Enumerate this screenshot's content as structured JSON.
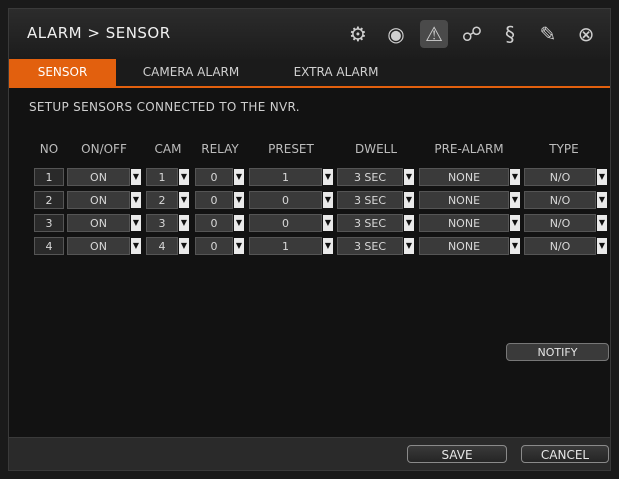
{
  "title": "ALARM > SENSOR",
  "toolbar_icons": [
    "gear-icon",
    "camera-lens-icon",
    "record-device-alert-icon",
    "network-icon",
    "system-icon",
    "pen-icon",
    "close-icon"
  ],
  "tabs": [
    {
      "label": "SENSOR",
      "active": true
    },
    {
      "label": "CAMERA ALARM",
      "active": false
    },
    {
      "label": "EXTRA ALARM",
      "active": false
    }
  ],
  "subtitle": "SETUP SENSORS CONNECTED TO THE NVR.",
  "columns": [
    "NO",
    "ON/OFF",
    "CAM",
    "RELAY",
    "PRESET",
    "DWELL",
    "PRE-ALARM",
    "TYPE"
  ],
  "rows": [
    {
      "no": "1",
      "on_off": "ON",
      "cam": "1",
      "relay": "0",
      "preset": "1",
      "dwell": "3 SEC",
      "pre_alarm": "NONE",
      "type": "N/O"
    },
    {
      "no": "2",
      "on_off": "ON",
      "cam": "2",
      "relay": "0",
      "preset": "0",
      "dwell": "3 SEC",
      "pre_alarm": "NONE",
      "type": "N/O"
    },
    {
      "no": "3",
      "on_off": "ON",
      "cam": "3",
      "relay": "0",
      "preset": "0",
      "dwell": "3 SEC",
      "pre_alarm": "NONE",
      "type": "N/O"
    },
    {
      "no": "4",
      "on_off": "ON",
      "cam": "4",
      "relay": "0",
      "preset": "1",
      "dwell": "3 SEC",
      "pre_alarm": "NONE",
      "type": "N/O"
    }
  ],
  "notify_label": "NOTIFY",
  "footer": {
    "save_label": "SAVE",
    "cancel_label": "CANCEL"
  },
  "colors": {
    "accent": "#e2600e"
  }
}
